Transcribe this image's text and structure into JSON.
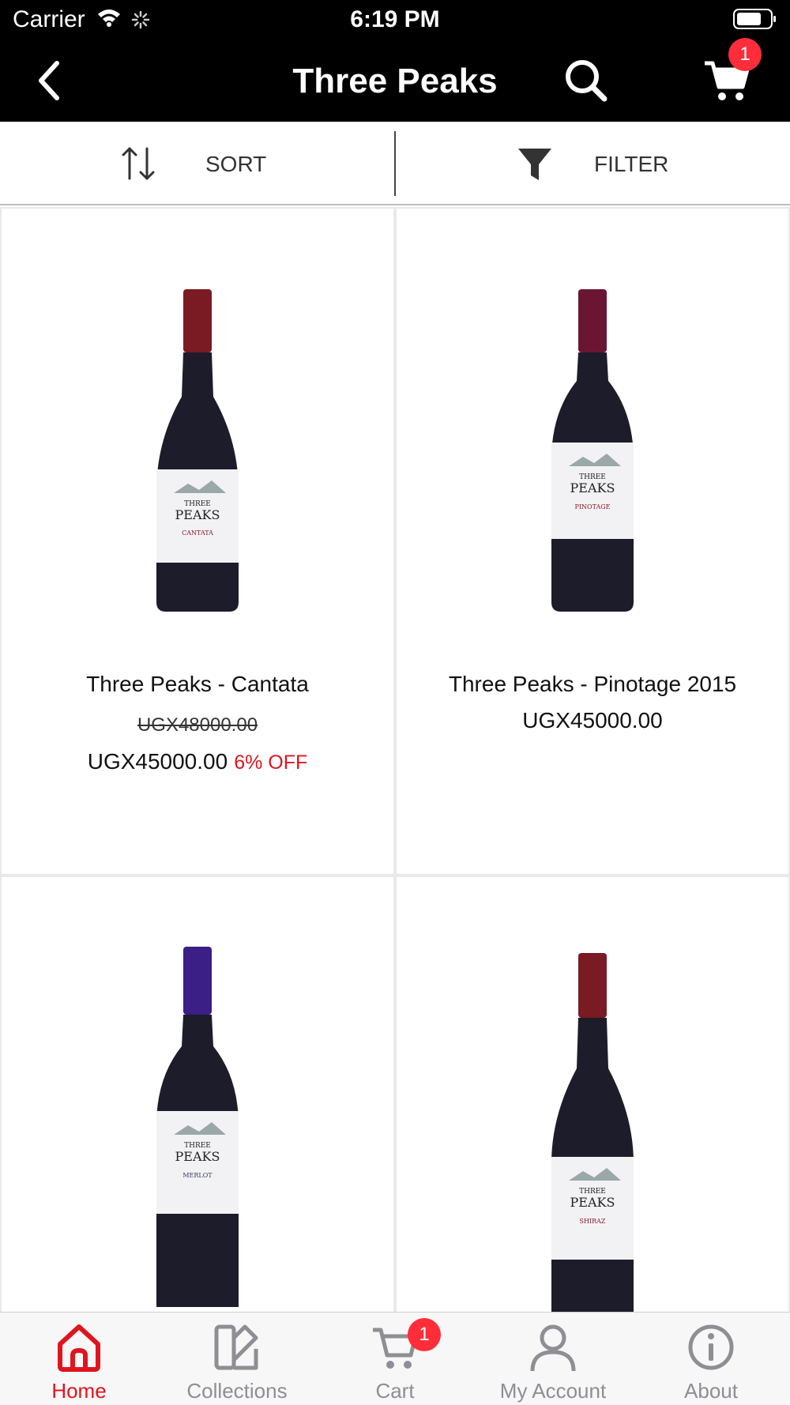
{
  "status_bar": {
    "carrier": "Carrier",
    "time": "6:19 PM"
  },
  "header": {
    "title": "Three Peaks",
    "cart_badge": "1"
  },
  "toolbar": {
    "sort_label": "SORT",
    "filter_label": "FILTER"
  },
  "colors": {
    "accent": "#e0141e",
    "badge": "#ff2d3a",
    "header_bg": "#000000",
    "tab_inactive": "#8e8e93"
  },
  "products": [
    {
      "name": "Three Peaks - Cantata",
      "old_price": "UGX48000.00",
      "price": "UGX45000.00",
      "discount": "6% OFF",
      "bottle_label": "CANTATA",
      "capsule_color": "#7a1a22"
    },
    {
      "name": "Three Peaks - Pinotage 2015",
      "price": "UGX45000.00",
      "bottle_label": "PINOTAGE",
      "capsule_color": "#6a1632"
    },
    {
      "name": "",
      "bottle_label": "MERLOT",
      "capsule_color": "#3b1e86"
    },
    {
      "name": "",
      "bottle_label": "SHIRAZ",
      "capsule_color": "#7a1a22"
    }
  ],
  "bottle_brand": {
    "line1": "THREE",
    "line2": "PEAKS"
  },
  "tabbar": {
    "items": [
      {
        "label": "Home",
        "icon": "home-icon",
        "active": true
      },
      {
        "label": "Collections",
        "icon": "collections-icon"
      },
      {
        "label": "Cart",
        "icon": "cart-icon",
        "badge": "1"
      },
      {
        "label": "My Account",
        "icon": "account-icon"
      },
      {
        "label": "About",
        "icon": "info-icon"
      }
    ]
  }
}
